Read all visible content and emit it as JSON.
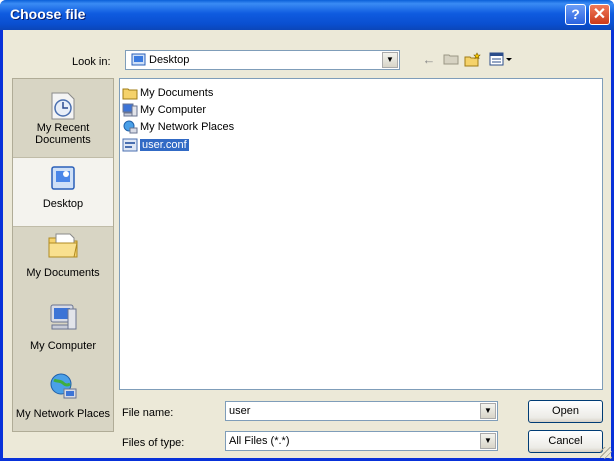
{
  "window": {
    "title": "Choose file",
    "help_glyph": "?",
    "close_glyph": "✕"
  },
  "look_in": {
    "label": "Look in:",
    "value": "Desktop",
    "icon": "desktop-icon"
  },
  "toolbar": {
    "back_glyph": "←",
    "up_glyph": "▭",
    "new_folder_glyph": "✱",
    "views_glyph": "▤▾"
  },
  "places": [
    {
      "label": "My Recent Documents",
      "icon": "recent-documents-icon"
    },
    {
      "label": "Desktop",
      "icon": "desktop-icon"
    },
    {
      "label": "My Documents",
      "icon": "my-documents-icon"
    },
    {
      "label": "My Computer",
      "icon": "my-computer-icon"
    },
    {
      "label": "My Network Places",
      "icon": "network-places-icon"
    }
  ],
  "files": [
    {
      "name": "My Documents",
      "icon": "folder-icon",
      "selected": false
    },
    {
      "name": "My Computer",
      "icon": "computer-icon",
      "selected": false
    },
    {
      "name": "My Network Places",
      "icon": "network-icon",
      "selected": false
    },
    {
      "name": "user.conf",
      "icon": "file-icon",
      "selected": true
    }
  ],
  "file_name": {
    "label": "File name:",
    "value": "user"
  },
  "file_type": {
    "label": "Files of type:",
    "value": "All Files (*.*)"
  },
  "buttons": {
    "open": "Open",
    "cancel": "Cancel"
  },
  "dropdown_glyph": "▼",
  "colors": {
    "title_bar": "#0a4fd0",
    "dialog_bg": "#ece9d8",
    "selection": "#316ac5",
    "close_button": "#cc3a1a"
  }
}
